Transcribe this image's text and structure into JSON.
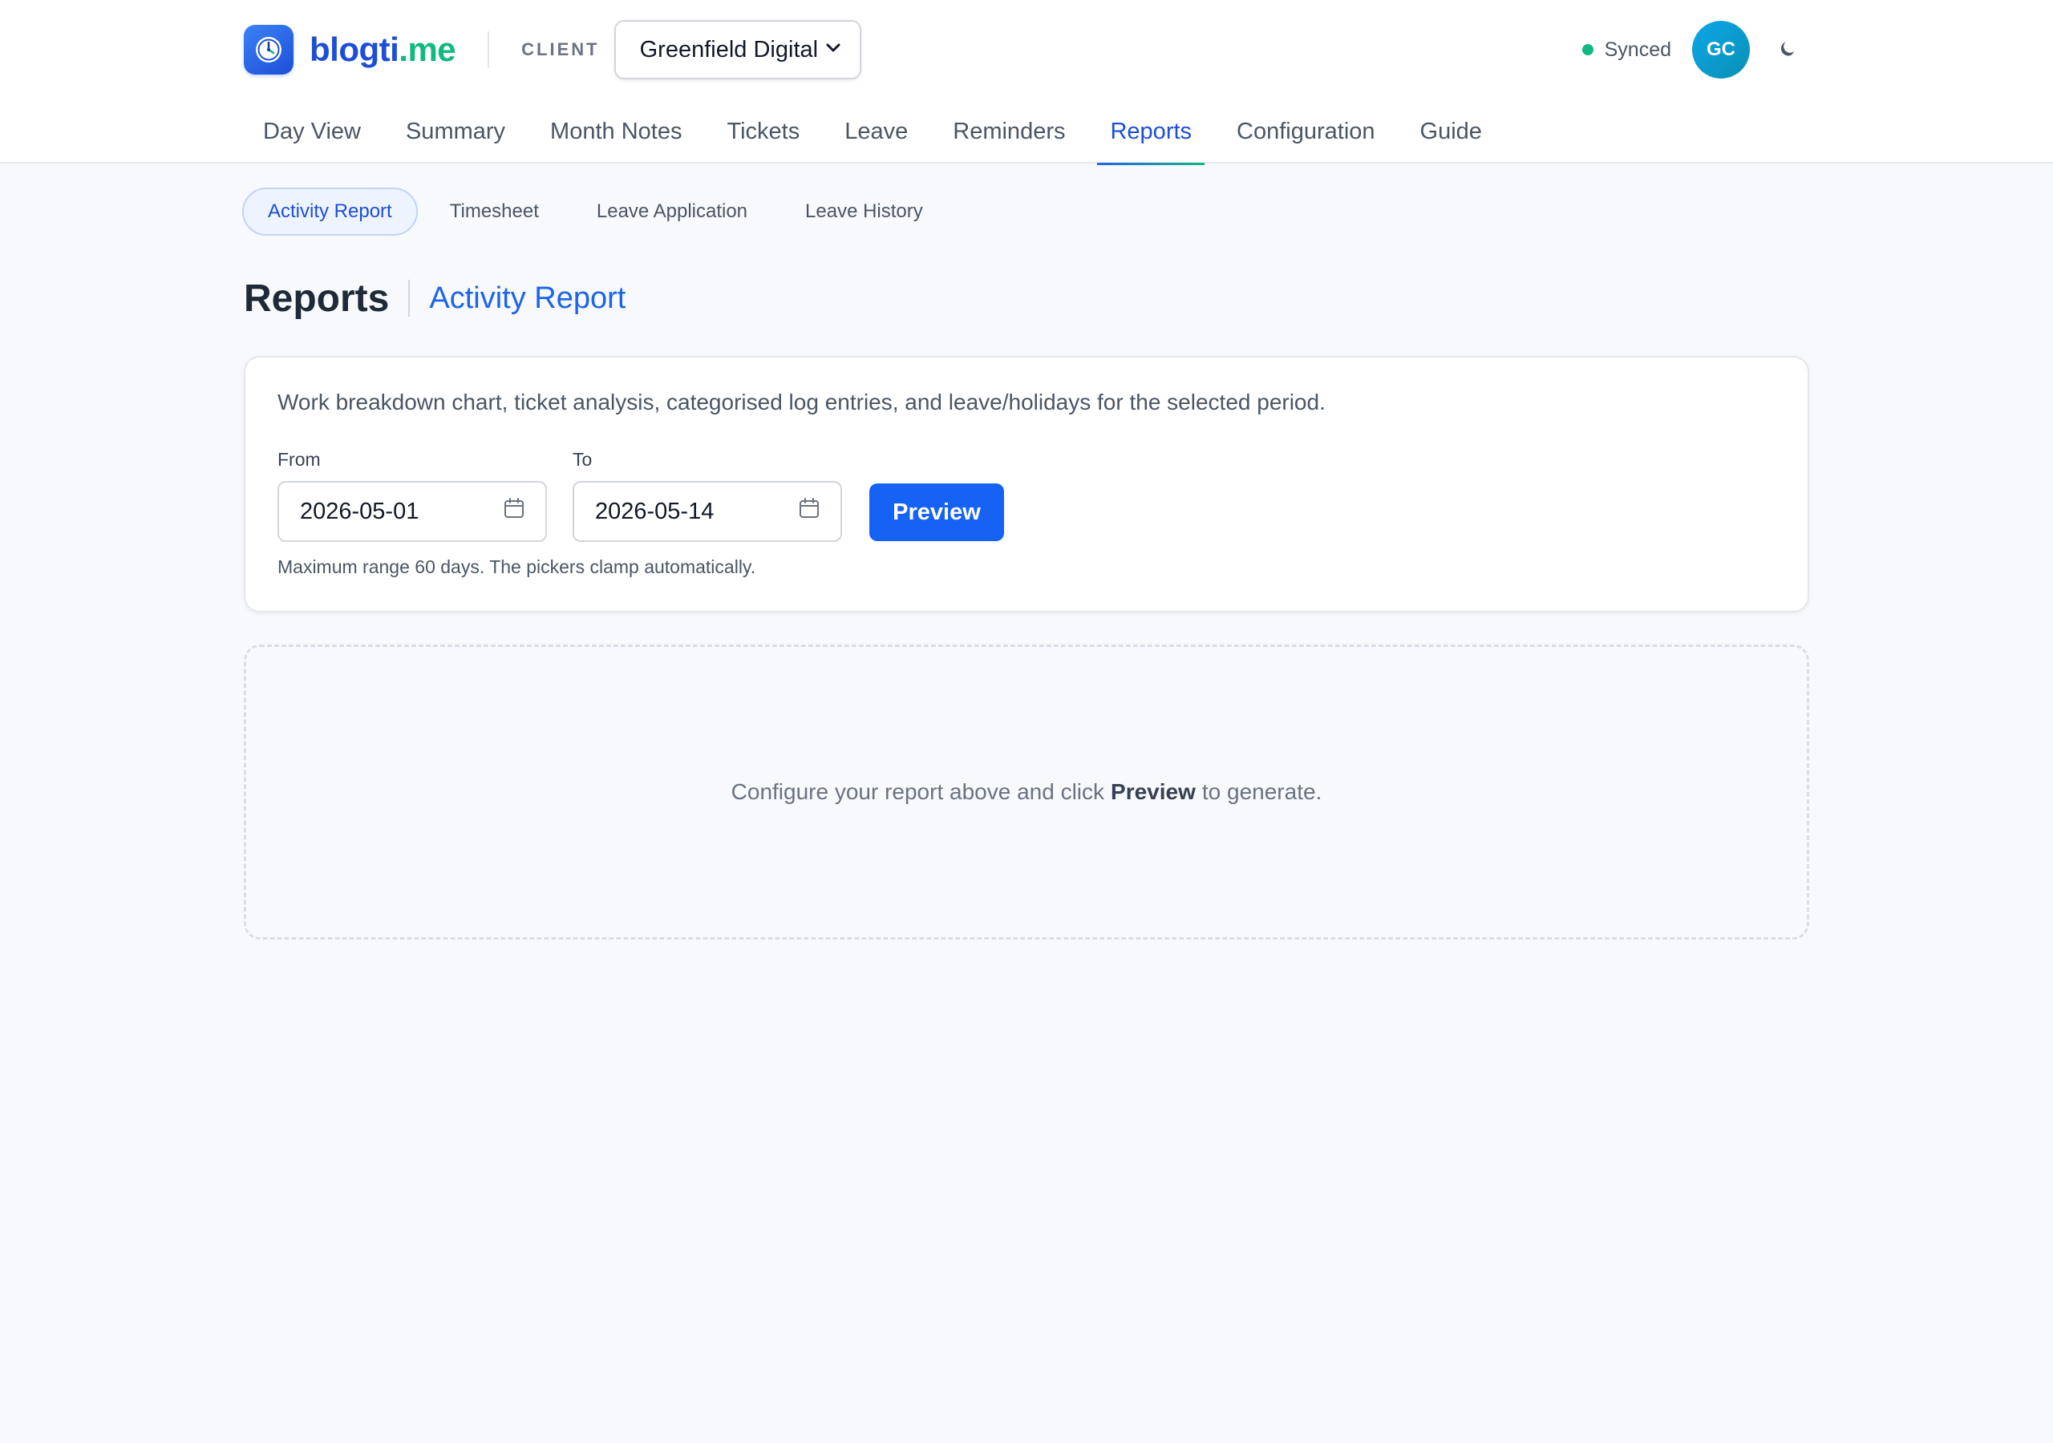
{
  "brand": {
    "name_a": "blogti",
    "name_b": ".me",
    "logo_icon": "clock-icon"
  },
  "client": {
    "label": "CLIENT",
    "selected": "Greenfield Digital"
  },
  "status": {
    "sync_text": "Synced",
    "sync_color": "#10b981",
    "avatar_initials": "GC",
    "theme_icon": "moon-icon"
  },
  "nav": {
    "tabs": [
      {
        "label": "Day View"
      },
      {
        "label": "Summary"
      },
      {
        "label": "Month Notes"
      },
      {
        "label": "Tickets"
      },
      {
        "label": "Leave"
      },
      {
        "label": "Reminders"
      },
      {
        "label": "Reports",
        "active": true
      },
      {
        "label": "Configuration"
      },
      {
        "label": "Guide"
      }
    ]
  },
  "subtabs": [
    {
      "label": "Activity Report",
      "active": true
    },
    {
      "label": "Timesheet"
    },
    {
      "label": "Leave Application"
    },
    {
      "label": "Leave History"
    }
  ],
  "page": {
    "title": "Reports",
    "subtitle": "Activity Report"
  },
  "form": {
    "description": "Work breakdown chart, ticket analysis, categorised log entries, and leave/holidays for the selected period.",
    "from_label": "From",
    "from_value": "2026-05-01",
    "to_label": "To",
    "to_value": "2026-05-14",
    "preview_label": "Preview",
    "hint": "Maximum range 60 days. The pickers clamp automatically."
  },
  "empty": {
    "before": "Configure your report above and click",
    "action": "Preview",
    "after": "to generate."
  },
  "colors": {
    "accent": "#1d4ed8",
    "brand_green": "#10b981",
    "button": "#1662f5"
  }
}
